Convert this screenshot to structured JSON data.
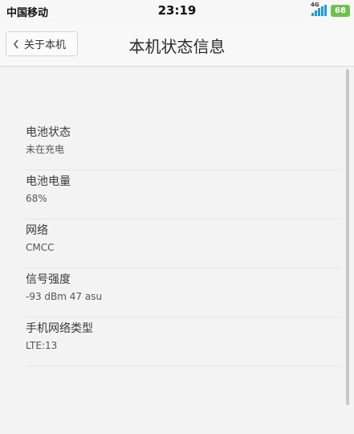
{
  "status_bar": {
    "carrier": "中国移动",
    "time": "23:19",
    "network_type": "4G",
    "battery": "68",
    "signal_icon": "signal-bars-icon"
  },
  "header": {
    "back_label": "关于本机",
    "title": "本机状态信息"
  },
  "items": [
    {
      "label": "电池状态",
      "value": "未在充电"
    },
    {
      "label": "电池电量",
      "value": "68%"
    },
    {
      "label": "网络",
      "value": "CMCC"
    },
    {
      "label": "信号强度",
      "value": "-93 dBm   47 asu"
    },
    {
      "label": "手机网络类型",
      "value": "LTE:13"
    }
  ],
  "colors": {
    "battery_green": "#6cc24a",
    "signal_blue": "#1e9be0"
  }
}
